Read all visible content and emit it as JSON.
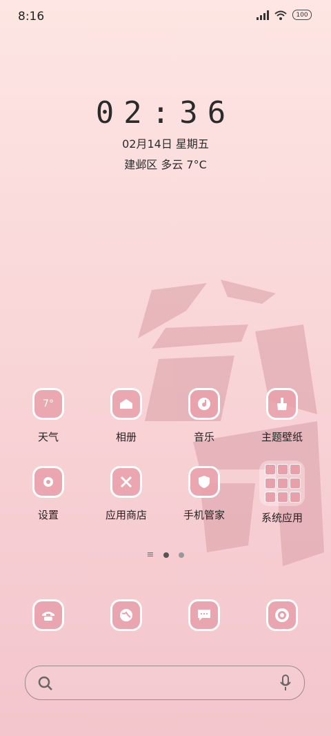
{
  "status": {
    "time": "8:16",
    "battery": "100"
  },
  "clock": {
    "time": "02:36",
    "date": "02月14日 星期五",
    "weather": "建邺区 多云 7°C"
  },
  "apps": [
    {
      "label": "天气",
      "icon": "weather-icon",
      "text": "7°"
    },
    {
      "label": "相册",
      "icon": "gallery-icon"
    },
    {
      "label": "音乐",
      "icon": "music-icon"
    },
    {
      "label": "主题壁纸",
      "icon": "theme-icon"
    },
    {
      "label": "设置",
      "icon": "settings-icon"
    },
    {
      "label": "应用商店",
      "icon": "app-store-icon"
    },
    {
      "label": "手机管家",
      "icon": "security-icon"
    },
    {
      "label": "系统应用",
      "icon": "folder-icon"
    }
  ],
  "dock": [
    {
      "icon": "phone-icon"
    },
    {
      "icon": "browser-icon"
    },
    {
      "icon": "messages-icon"
    },
    {
      "icon": "camera-icon"
    }
  ],
  "colors": {
    "icon_bg": "#e8a0aa",
    "accent": "#ffffff"
  }
}
